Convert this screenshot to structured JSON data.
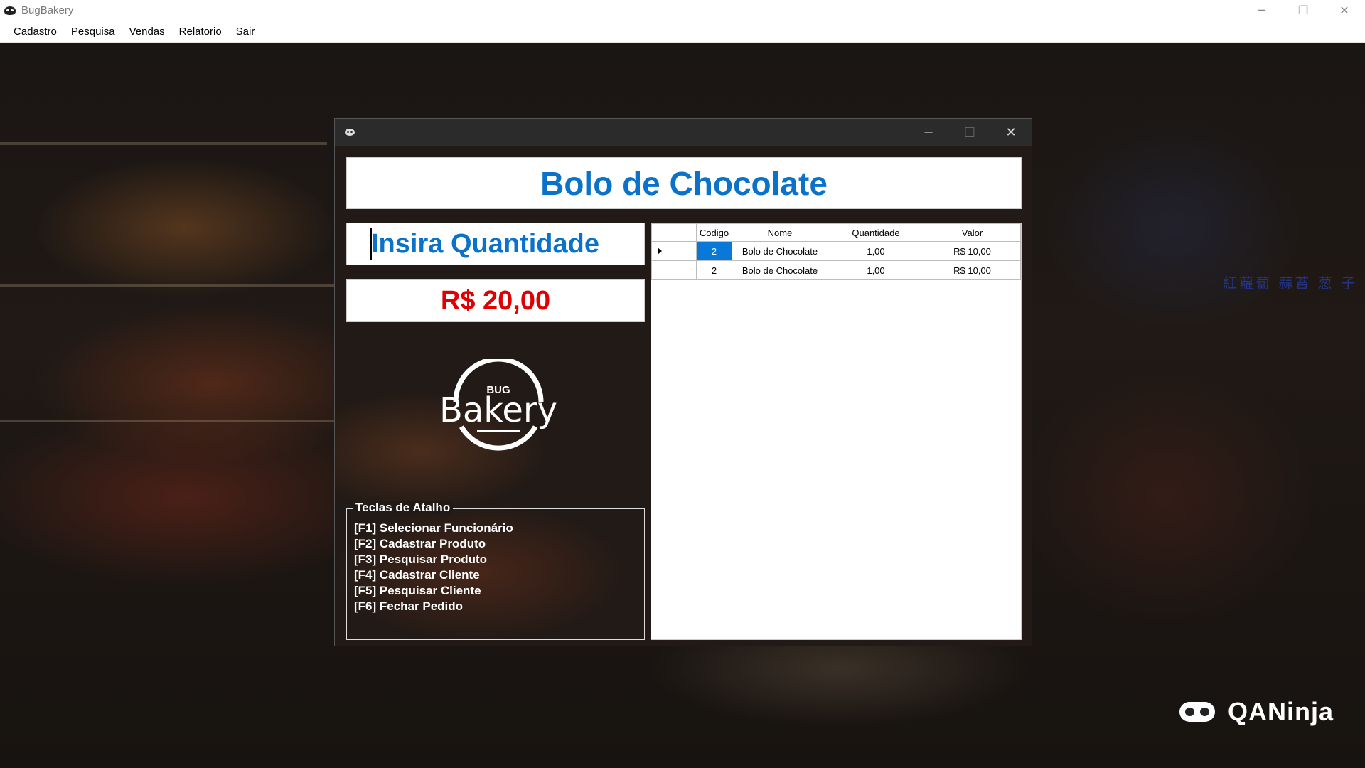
{
  "window": {
    "title": "BugBakery",
    "controls": {
      "minimize": "─",
      "restore": "❐",
      "close": "✕"
    }
  },
  "menu": [
    "Cadastro",
    "Pesquisa",
    "Vendas",
    "Relatorio",
    "Sair"
  ],
  "sale_window": {
    "controls": {
      "minimize": "─",
      "maximize": "☐",
      "close": "✕"
    },
    "product_name": "Bolo de Chocolate",
    "quantity_placeholder": "Insira Quantidade",
    "total": "R$ 20,00",
    "logo": {
      "top": "BUG",
      "main": "Bakery"
    },
    "shortcuts": {
      "title": "Teclas de Atalho",
      "items": [
        "[F1] Selecionar Funcionário",
        "[F2] Cadastrar Produto",
        "[F3] Pesquisar Produto",
        "[F4] Cadastrar Cliente",
        "[F5] Pesquisar Cliente",
        "[F6] Fechar Pedido"
      ]
    },
    "grid": {
      "columns": [
        "Codigo",
        "Nome",
        "Quantidade",
        "Valor"
      ],
      "rows": [
        [
          "2",
          "Bolo de Chocolate",
          "1,00",
          "R$ 10,00"
        ],
        [
          "2",
          "Bolo de Chocolate",
          "1,00",
          "R$ 10,00"
        ]
      ]
    }
  },
  "background": {
    "neon_sign": "紅蘿蔔 蒜苔 葱 子",
    "brand": "QANinja"
  },
  "colors": {
    "title_blue": "#0a73c9",
    "total_red": "#e00000",
    "selected_cell": "#0a78d7"
  }
}
